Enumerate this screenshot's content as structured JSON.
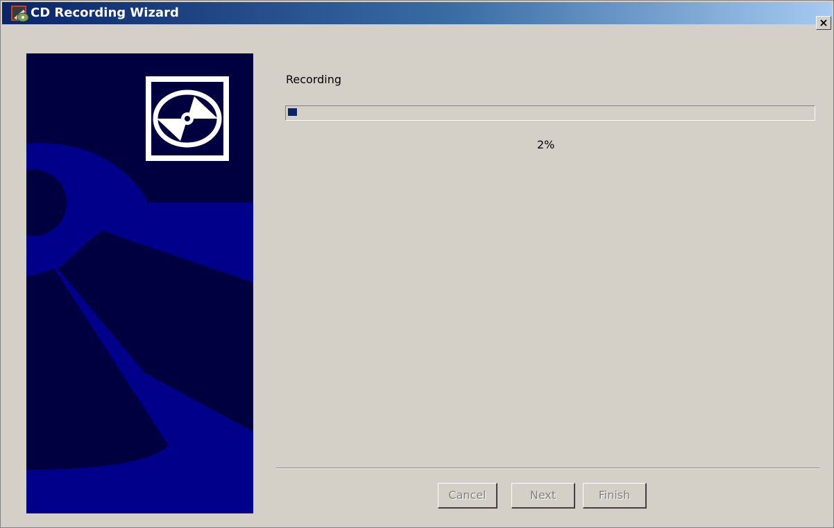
{
  "window": {
    "title": "CD Recording Wizard",
    "close_label": "×"
  },
  "main": {
    "stage_label": "Recording",
    "progress_percent_value": 2,
    "progress_text": "2%"
  },
  "buttons": {
    "cancel": "Cancel",
    "next": "Next",
    "finish": "Finish"
  },
  "colors": {
    "title_start": "#0a246a",
    "title_end": "#a6caf0",
    "banner_bg": "#000040",
    "banner_shape": "#00008b",
    "progress_fill": "#0a246a",
    "dialog_bg": "#d4d0c8"
  },
  "icons": {
    "app": "cd-recording-icon",
    "banner": "cd-disc-icon",
    "close": "close-icon"
  }
}
